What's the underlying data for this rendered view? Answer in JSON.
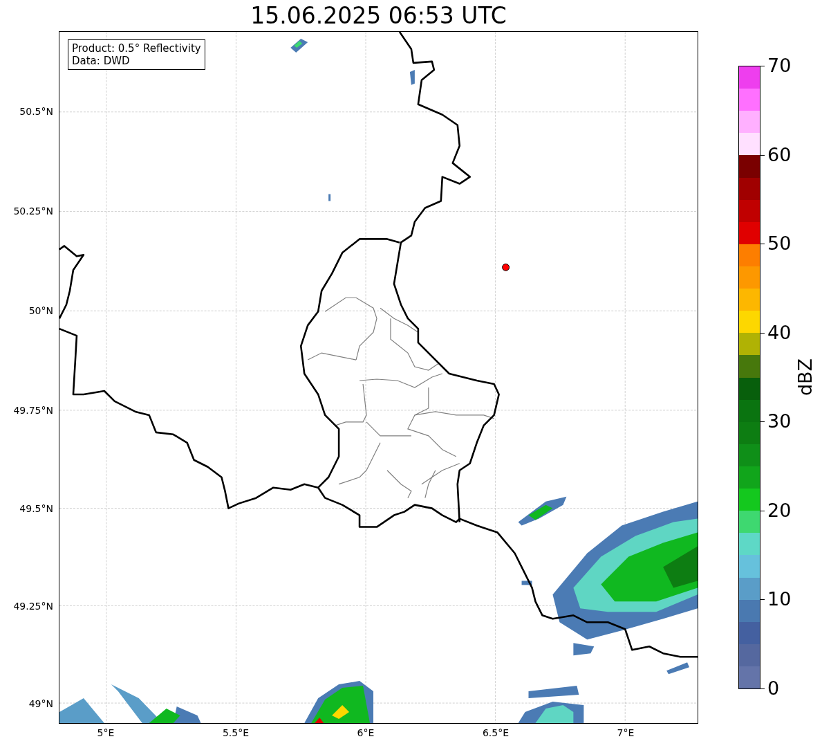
{
  "title": "15.06.2025 06:53 UTC",
  "info_box": [
    "Product: 0.5° Reflectivity",
    "Data: DWD"
  ],
  "latitude_labels": [
    "50.5°N",
    "50.25°N",
    "50°N",
    "49.75°N",
    "49.5°N",
    "49.25°N",
    "49°N"
  ],
  "longitude_labels": [
    "5°E",
    "5.5°E",
    "6°E",
    "6.5°E",
    "7°E"
  ],
  "colorbar": {
    "label": "dBZ",
    "ticks": [
      "70",
      "60",
      "50",
      "40",
      "30",
      "20",
      "10",
      "0"
    ],
    "bins": [
      {
        "color": "#ee3eee"
      },
      {
        "color": "#ff70ff"
      },
      {
        "color": "#ffb0ff"
      },
      {
        "color": "#ffe0ff"
      },
      {
        "color": "#7a0000"
      },
      {
        "color": "#a00000"
      },
      {
        "color": "#c00000"
      },
      {
        "color": "#e00000"
      },
      {
        "color": "#fd7e00"
      },
      {
        "color": "#fd9800"
      },
      {
        "color": "#fdb700"
      },
      {
        "color": "#fdd700"
      },
      {
        "color": "#b0b204"
      },
      {
        "color": "#47780c"
      },
      {
        "color": "#085f0c"
      },
      {
        "color": "#0a7410"
      },
      {
        "color": "#0d7d12"
      },
      {
        "color": "#0f8f18"
      },
      {
        "color": "#11a51b"
      },
      {
        "color": "#14c81e"
      },
      {
        "color": "#3ed870"
      },
      {
        "color": "#5ed8c6"
      },
      {
        "color": "#66c1dc"
      },
      {
        "color": "#5a9dc8"
      },
      {
        "color": "#4a79b0"
      },
      {
        "color": "#4460a0"
      },
      {
        "color": "#55689f"
      },
      {
        "color": "#6474a9"
      }
    ]
  }
}
